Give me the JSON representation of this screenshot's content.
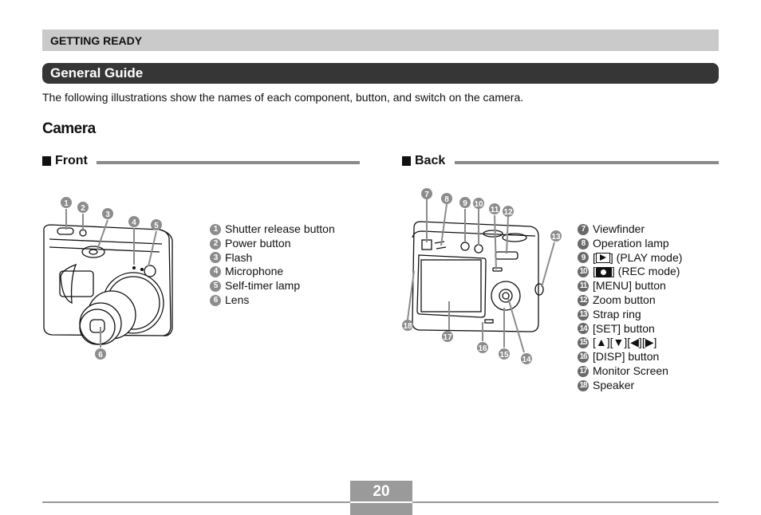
{
  "header": {
    "section": "GETTING READY",
    "title": "General Guide"
  },
  "intro": "The following illustrations show the names of each component, button, and switch on the camera.",
  "heading": "Camera",
  "front": {
    "label": "Front",
    "items": [
      {
        "num": "1",
        "label": "Shutter release button"
      },
      {
        "num": "2",
        "label": "Power button"
      },
      {
        "num": "3",
        "label": "Flash"
      },
      {
        "num": "4",
        "label": "Microphone"
      },
      {
        "num": "5",
        "label": "Self-timer lamp"
      },
      {
        "num": "6",
        "label": "Lens"
      }
    ]
  },
  "back": {
    "label": "Back",
    "items": [
      {
        "num": "7",
        "label": "Viewfinder"
      },
      {
        "num": "8",
        "label": "Operation lamp"
      },
      {
        "num": "9",
        "pre": "[",
        "icon": "play-icon",
        "label": "] (PLAY mode)"
      },
      {
        "num": "10",
        "pre": "[",
        "icon": "camera-icon",
        "label": "] (REC mode)"
      },
      {
        "num": "11",
        "label": "[MENU] button"
      },
      {
        "num": "12",
        "label": "Zoom button"
      },
      {
        "num": "13",
        "label": "Strap ring"
      },
      {
        "num": "14",
        "label": "[SET] button"
      },
      {
        "num": "15",
        "label": "[▲][▼][◀][▶]"
      },
      {
        "num": "16",
        "label": "[DISP] button"
      },
      {
        "num": "17",
        "label": "Monitor Screen"
      },
      {
        "num": "18",
        "label": "Speaker"
      }
    ]
  },
  "page_number": "20"
}
